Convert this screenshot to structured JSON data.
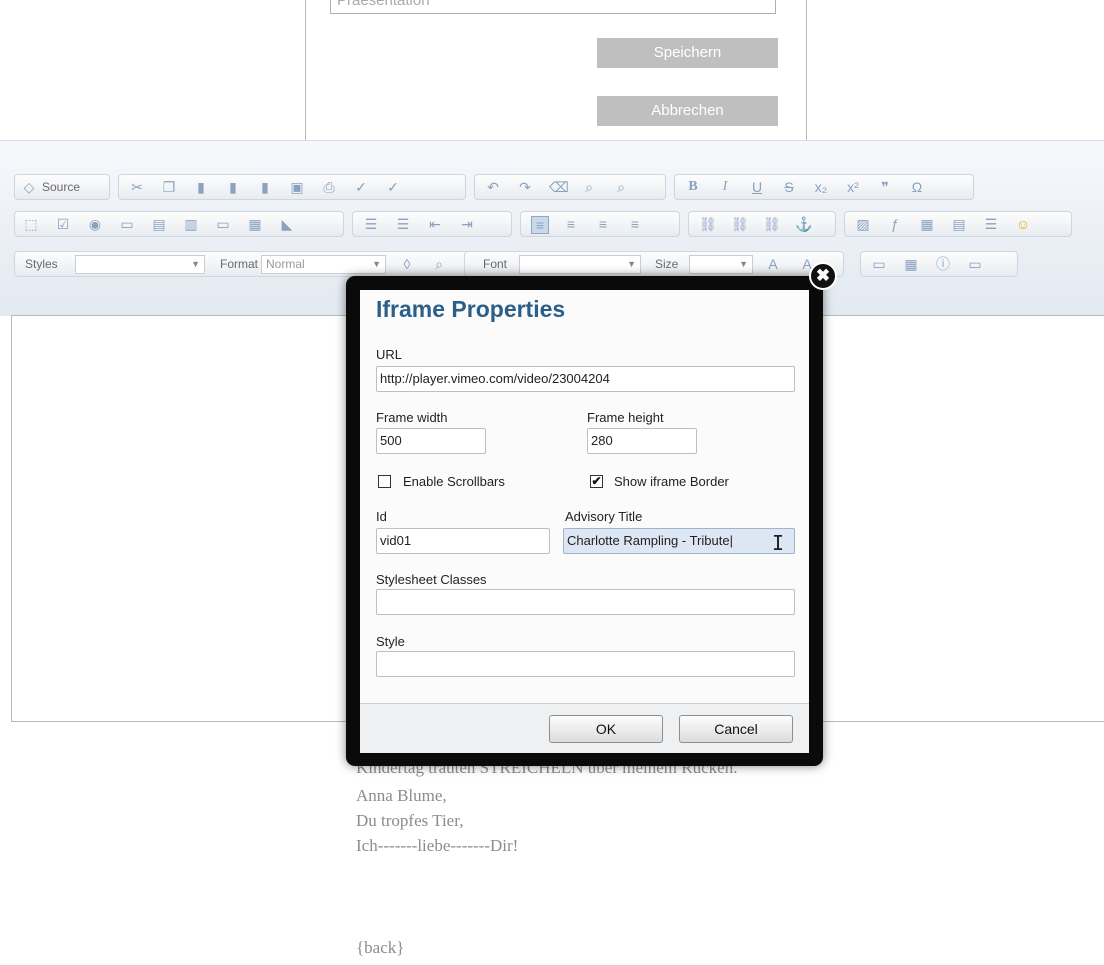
{
  "top_form": {
    "previous_field_value": "Praesentation",
    "save_label": "Speichern",
    "cancel_label": "Abbrechen"
  },
  "toolbar": {
    "source_label": "Source",
    "styles_label": "Styles",
    "format_label": "Format",
    "format_value": "Normal",
    "font_label": "Font",
    "size_label": "Size"
  },
  "poem": {
    "line1": "Kindertag trauten STREICHELN über meinem Rücken.",
    "line2": "Anna Blume,",
    "line3": "Du tropfes Tier,",
    "line4": "Ich-------liebe-------Dir!",
    "back": "{back}"
  },
  "dialog": {
    "title": "Iframe Properties",
    "url_label": "URL",
    "url_value": "http://player.vimeo.com/video/23004204",
    "width_label": "Frame width",
    "width_value": "500",
    "height_label": "Frame height",
    "height_value": "280",
    "scrollbars_label": "Enable Scrollbars",
    "scrollbars_checked": false,
    "border_label": "Show iframe Border",
    "border_checked": true,
    "id_label": "Id",
    "id_value": "vid01",
    "advisory_label": "Advisory Title",
    "advisory_value": "Charlotte Rampling - Tribute|",
    "classes_label": "Stylesheet Classes",
    "classes_value": "",
    "style_label": "Style",
    "style_value": "",
    "ok_label": "OK",
    "cancel_label": "Cancel",
    "close_glyph": "✖",
    "check_glyph": "✔"
  },
  "colors": {
    "dialog_title": "#2b5f88",
    "gray_button": "#bfbfbf",
    "modal_border": "#0a0a0a"
  }
}
